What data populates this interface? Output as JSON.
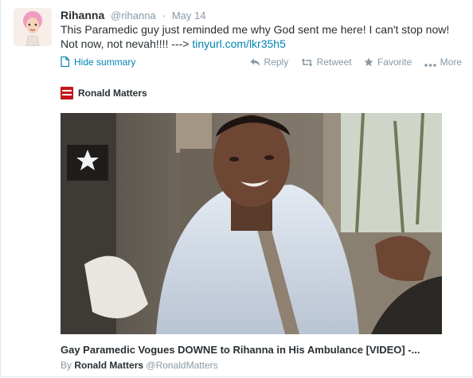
{
  "tweet": {
    "fullname": "Rihanna",
    "username": "@rihanna",
    "separator": "·",
    "time": "May 14",
    "text": "This Paramedic guy just reminded me why God sent me here! I can't stop now! Not now, not nevah!!!! --->",
    "link": "tinyurl.com/lkr35h5"
  },
  "actions": {
    "hide_summary": "Hide summary",
    "reply": "Reply",
    "retweet": "Retweet",
    "favorite": "Favorite",
    "more": "More"
  },
  "card": {
    "source_name": "Ronald Matters",
    "title": "Gay Paramedic Vogues DOWNE to Rihanna in His Ambulance [VIDEO] -...",
    "byline_prefix": "By",
    "author": "Ronald Matters",
    "author_handle": "@RonaldMatters"
  },
  "colors": {
    "link": "#0084b4",
    "muted": "#8899a6",
    "text": "#292f33",
    "source_logo": "#c4161c"
  },
  "icons": [
    "document-icon",
    "reply-icon",
    "retweet-icon",
    "star-icon",
    "more-dots-icon",
    "source-logo"
  ]
}
